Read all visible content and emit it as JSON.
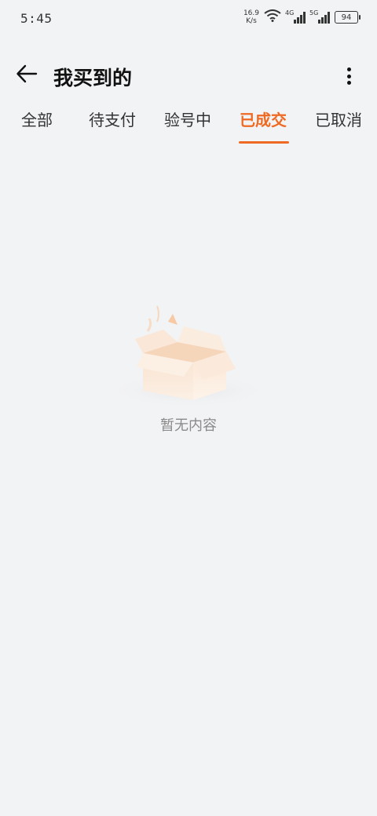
{
  "status_bar": {
    "time": "5:45",
    "net_speed_value": "16.9",
    "net_speed_unit": "K/s",
    "signal1_label": "4G",
    "signal2_label": "5G",
    "battery": "94"
  },
  "header": {
    "title": "我买到的"
  },
  "tabs": [
    {
      "label": "全部"
    },
    {
      "label": "待支付"
    },
    {
      "label": "验号中"
    },
    {
      "label": "已成交"
    },
    {
      "label": "已取消"
    }
  ],
  "active_tab": "已成交",
  "empty_state": {
    "message": "暂无内容"
  },
  "colors": {
    "accent": "#ee6a23",
    "background": "#f2f3f5"
  }
}
